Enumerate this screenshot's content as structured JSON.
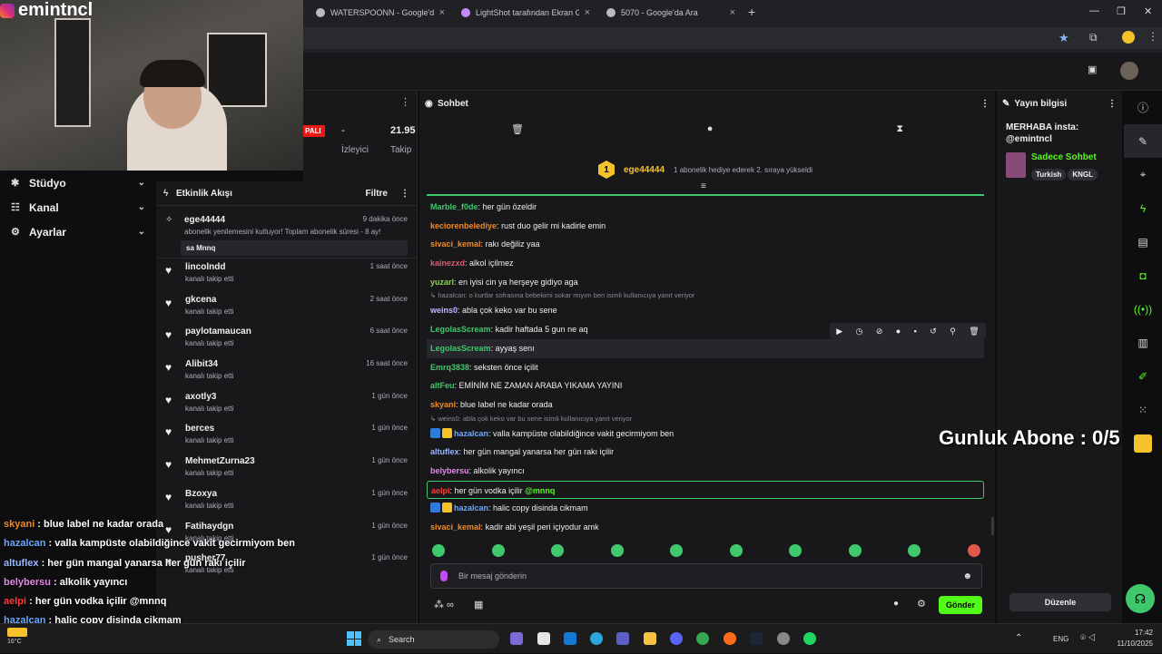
{
  "browser": {
    "tabs": [
      {
        "label": "WATERSPOONN - Google'da Ar"
      },
      {
        "label": "LightShot tarafından Ekran Gör"
      },
      {
        "label": "5070 - Google'da Ara"
      }
    ],
    "new_tab": "+",
    "close_glyph": "×"
  },
  "webcam": {
    "streamer_name": "emintncl",
    "paper_label": "PALI"
  },
  "left_nav": {
    "items": [
      {
        "label": "Stüdyo",
        "icon": "settings-gear-icon"
      },
      {
        "label": "Kanal",
        "icon": "users-icon"
      },
      {
        "label": "Ayarlar",
        "icon": "gear-icon"
      }
    ]
  },
  "stats": {
    "dash": "-",
    "viewers_label": "İzleyici",
    "followers_value": "21.95",
    "followers_label": "Takip"
  },
  "activity": {
    "title": "Etkinlik Akışı",
    "filter_label": "Filtre",
    "featured": {
      "name": "ege44444",
      "time": "9 dakika önce",
      "message": "abonelik yenilemesini kutluyor! Toplam abonelik süresi - 8 ay!",
      "reply": "sa Mnnq"
    },
    "items": [
      {
        "name": "lincolndd",
        "time": "1 saat önce",
        "action": "kanalı takip etti"
      },
      {
        "name": "gkcena",
        "time": "2 saat önce",
        "action": "kanalı takip etti"
      },
      {
        "name": "paylotamaucan",
        "time": "6 saat önce",
        "action": "kanalı takip etti"
      },
      {
        "name": "Alibit34",
        "time": "16 saat önce",
        "action": "kanalı takip etti"
      },
      {
        "name": "axotly3",
        "time": "1 gün önce",
        "action": "kanalı takip etti"
      },
      {
        "name": "berces",
        "time": "1 gün önce",
        "action": "kanalı takip etti"
      },
      {
        "name": "MehmetZurna23",
        "time": "1 gün önce",
        "action": "kanalı takip etti"
      },
      {
        "name": "Bzoxya",
        "time": "1 gün önce",
        "action": "kanalı takip etti"
      },
      {
        "name": "Fatihaydgn",
        "time": "1 gün önce",
        "action": "kanalı takip etti"
      },
      {
        "name": "pusher77",
        "time": "1 gün önce",
        "action": "kanalı takip etti"
      }
    ]
  },
  "chat": {
    "title": "Sohbet",
    "pinned": {
      "name": "ege44444",
      "rank": "1",
      "text": "1 abonelik hediye ederek 2. sıraya yükseldi"
    },
    "messages": [
      {
        "user": "Marble_f0de",
        "color": "#3fc96c",
        "text": "her gün özeldir"
      },
      {
        "user": "keciorenbelediye",
        "color": "#f08a24",
        "text": "rust duo gelir mi kadirle emin"
      },
      {
        "user": "sivaci_kemal",
        "color": "#f08a24",
        "text": "rakı değiliz yaa"
      },
      {
        "user": "kainezxd",
        "color": "#e05a7a",
        "text": "alkol içilmez"
      },
      {
        "user": "yuzarl",
        "color": "#8fd14f",
        "text": "en iyisi cin ya herşeye gidiyo aga"
      },
      {
        "reply": "hazalcan: o kurtlar sofrasına bebekimi sokar mıyım ben isimli kullanıcıya yanıt veriyor"
      },
      {
        "user": "weins0",
        "color": "#c7b3ff",
        "text": "abla çok keko var bu sene"
      },
      {
        "user": "LegolasScream",
        "color": "#3fc96c",
        "text": "kadir haftada 5 gun ne aq"
      },
      {
        "user": "LegolasScream",
        "color": "#3fc96c",
        "text": "ayyaş senı",
        "hover": true
      },
      {
        "user": "Emrq3838",
        "color": "#3fc96c",
        "text": "seksten önce içilit"
      },
      {
        "user": "altFeu",
        "color": "#3fc96c",
        "text": "EMİNİM NE ZAMAN ARABA YIKAMA YAYINI"
      },
      {
        "user": "skyani",
        "color": "#f08a24",
        "text": "blue label ne kadar orada"
      },
      {
        "reply": "weins0: abla çok keko var bu sene isimli kullanıcıya yanıt veriyor"
      },
      {
        "user": "hazalcan",
        "color": "#6aa8ff",
        "text": "valla kampüste olabildiğince vakit gecirmiyom ben",
        "badges": true
      },
      {
        "user": "altuflex",
        "color": "#9ab7ff",
        "text": "her gün mangal yanarsa her gün rakı içilir"
      },
      {
        "user": "belybersu",
        "color": "#e58ae8",
        "text": "alkolik yayıncı"
      },
      {
        "user": "aelpi",
        "color": "#ff3b3b",
        "text": "her gün vodka içilir",
        "mention": "@mnnq",
        "highlight": true
      },
      {
        "user": "hazalcan",
        "color": "#6aa8ff",
        "text": "halic copy disinda cikmam",
        "badges": true
      },
      {
        "user": "sivaci_kemal",
        "color": "#f08a24",
        "text": "kadir abi yeşil peri içiyodur amk"
      }
    ],
    "input_placeholder": "Bir mesaj gönderin",
    "send_label": "Gönder"
  },
  "stream_info": {
    "title": "Yayın bilgisi",
    "stream_title": "MERHABA insta:\n@emintncl",
    "category": "Sadece Sohbet",
    "tags": [
      "Turkish",
      "KNGL"
    ],
    "edit_label": "Düzenle"
  },
  "overlay": {
    "sub_goal": "Gunluk Abone : 0/5",
    "chat": [
      {
        "user": "skyani",
        "color": "#f08a24",
        "text": "blue label ne kadar orada"
      },
      {
        "user": "hazalcan",
        "color": "#6aa8ff",
        "text": "valla kampüste olabildiğince vakit gecirmiyom ben"
      },
      {
        "user": "altuflex",
        "color": "#9ab7ff",
        "text": "her gün mangal yanarsa her gün rakı içilir"
      },
      {
        "user": "belybersu",
        "color": "#e58ae8",
        "text": "alkolik yayıncı"
      },
      {
        "user": "aelpi",
        "color": "#ff3b3b",
        "text": "her gün vodka içilir @mnnq"
      },
      {
        "user": "hazalcan",
        "color": "#6aa8ff",
        "text": "halic copy disinda cikmam"
      },
      {
        "user": "sivaci_kemal",
        "color": "#f08a24",
        "text": "kadir abi yeşil peri içiyodur amk"
      }
    ]
  },
  "taskbar": {
    "search_label": "Search",
    "weather": "16°C",
    "lang": "ENG",
    "time": "17:42",
    "date": "11/10/2025"
  },
  "colors": {
    "accent": "#53fc18",
    "highlight_border": "#3fc96c",
    "panel": "#18181b"
  }
}
